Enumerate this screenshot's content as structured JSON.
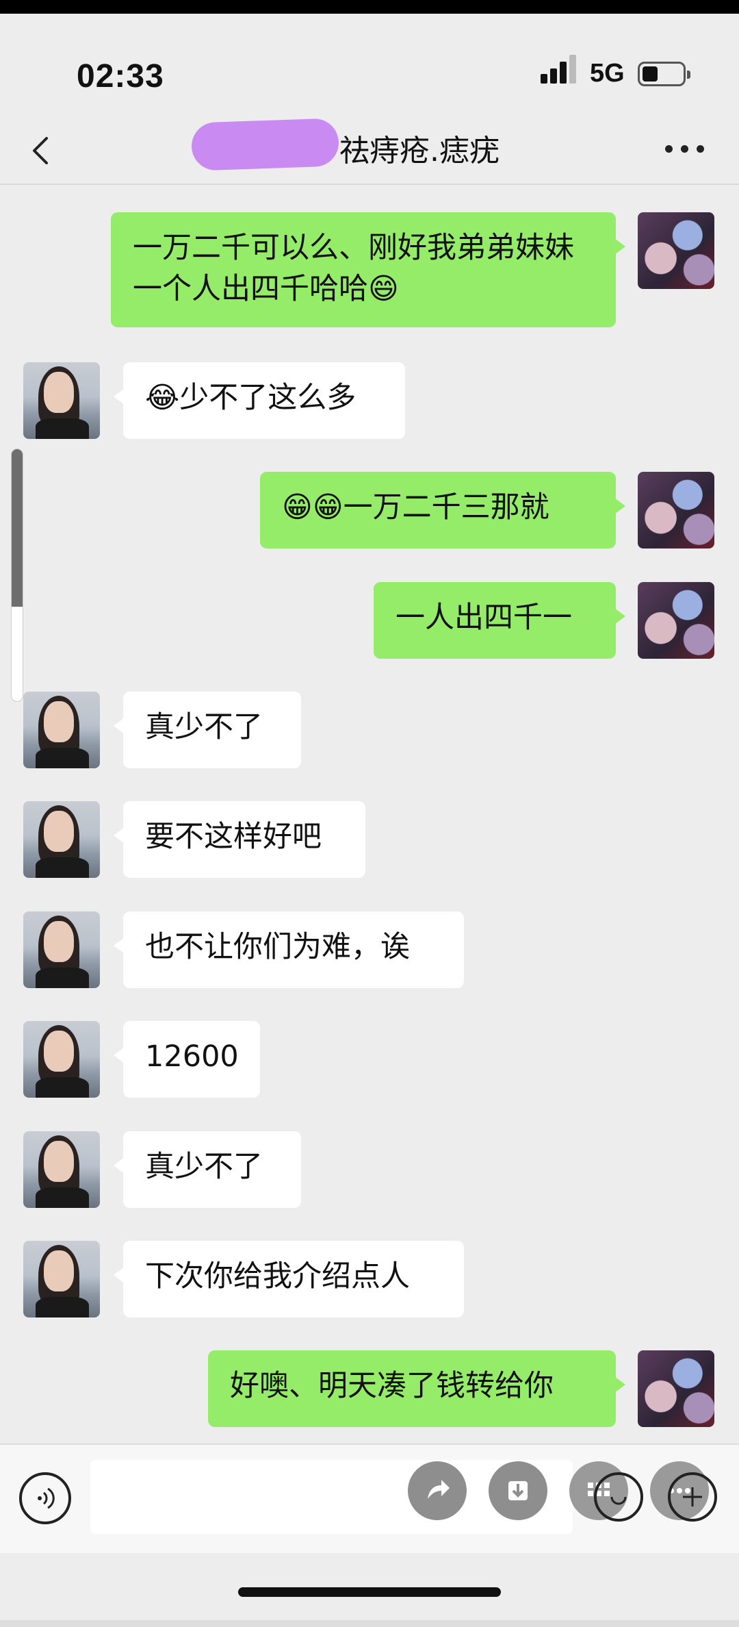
{
  "status_bar": {
    "time": "02:33",
    "network": "5G"
  },
  "nav": {
    "title": "祛痔疮.痣疣"
  },
  "messages": [
    {
      "from": "me",
      "text": "一万二千可以么、刚好我弟弟妹妹一个人出四千哈哈😄"
    },
    {
      "from": "her",
      "text": "😂少不了这么多"
    },
    {
      "from": "me",
      "text": "😁😁一万二千三那就"
    },
    {
      "from": "me",
      "text": "一人出四千一"
    },
    {
      "from": "her",
      "text": "真少不了"
    },
    {
      "from": "her",
      "text": "要不这样好吧"
    },
    {
      "from": "her",
      "text": "也不让你们为难，诶"
    },
    {
      "from": "her",
      "text": "12600"
    },
    {
      "from": "her",
      "text": "真少不了"
    },
    {
      "from": "her",
      "text": "下次你给我介绍点人"
    },
    {
      "from": "me",
      "text": "好噢、明天凑了钱转给你"
    }
  ],
  "input_bar": {
    "icons": [
      "voice-icon",
      "share-icon",
      "download-icon",
      "emoji-icon",
      "add-icon"
    ]
  }
}
